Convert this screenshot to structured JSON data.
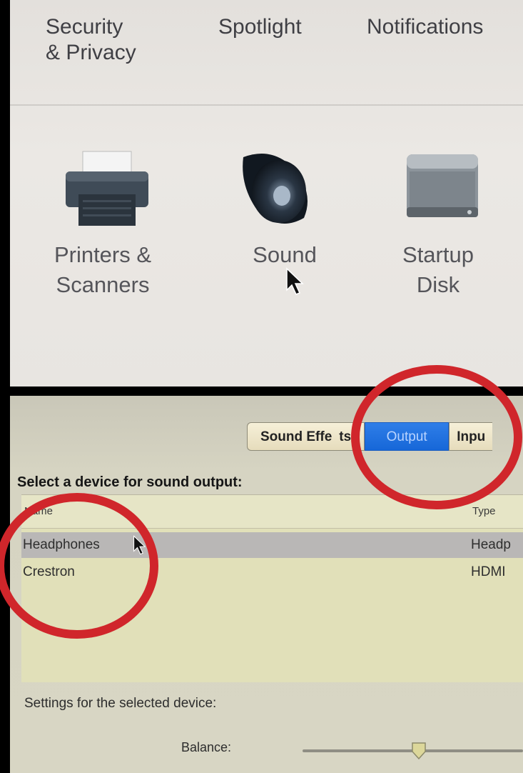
{
  "system_preferences": {
    "top_row": [
      {
        "label": "Security\n& Privacy"
      },
      {
        "label": "Spotlight"
      },
      {
        "label": "Notifications"
      }
    ],
    "items": [
      {
        "label": "Printers &\nScanners",
        "icon": "printer-icon"
      },
      {
        "label": "Sound",
        "icon": "speaker-icon"
      },
      {
        "label": "Startup\nDisk",
        "icon": "hard-disk-icon"
      }
    ]
  },
  "sound_prefs": {
    "tabs": [
      "Sound Effe",
      "ts",
      "Output",
      "Inpu"
    ],
    "active_tab": "Output",
    "select_title": "Select a device for sound output:",
    "columns": [
      "Name",
      "Type"
    ],
    "devices": [
      {
        "name": "Headphones",
        "type": "Headp",
        "selected": true
      },
      {
        "name": "Crestron",
        "type": "HDMI",
        "selected": false
      }
    ],
    "settings_title": "Settings for the selected device:",
    "balance_label": "Balance:",
    "balance_value": 0.5
  },
  "colors": {
    "annotation": "#d0262b",
    "selection": "#1667d8"
  }
}
